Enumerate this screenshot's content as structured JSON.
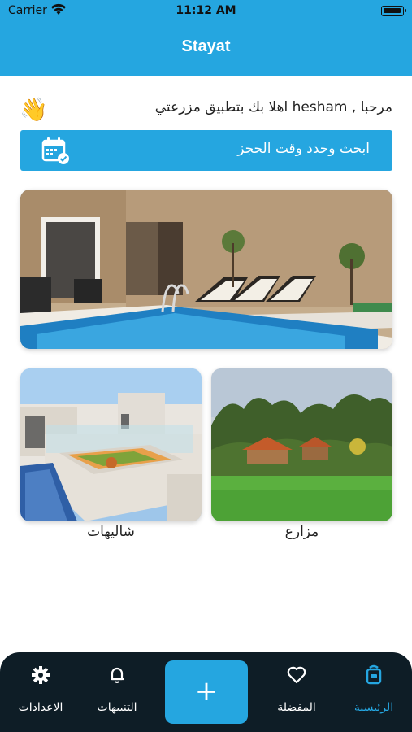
{
  "status_bar": {
    "carrier": "Carrier",
    "time": "11:12 AM"
  },
  "nav": {
    "title": "Stayat"
  },
  "greeting": {
    "text": "مرحبا , hesham اهلا بك بتطبيق مزرعتي",
    "icon": "waving-hand-icon"
  },
  "search": {
    "label": "ابحث وحدد وقت الحجز",
    "icon": "calendar-check-icon"
  },
  "categories": [
    {
      "label": "مزارع",
      "image": "farm-photo"
    },
    {
      "label": "شاليهات",
      "image": "chalet-photo"
    }
  ],
  "hero": {
    "image": "pool-photo"
  },
  "tabs": [
    {
      "label": "الرئيسية",
      "icon": "home-icon",
      "active": true
    },
    {
      "label": "المفضلة",
      "icon": "heart-icon",
      "active": false
    },
    {
      "label": "التنبيهات",
      "icon": "bell-icon",
      "active": false
    },
    {
      "label": "الاعدادات",
      "icon": "gear-icon",
      "active": false
    }
  ],
  "add_button": {
    "label": "+"
  },
  "colors": {
    "primary": "#25a6e0",
    "tab_bar": "#0e1d26"
  }
}
